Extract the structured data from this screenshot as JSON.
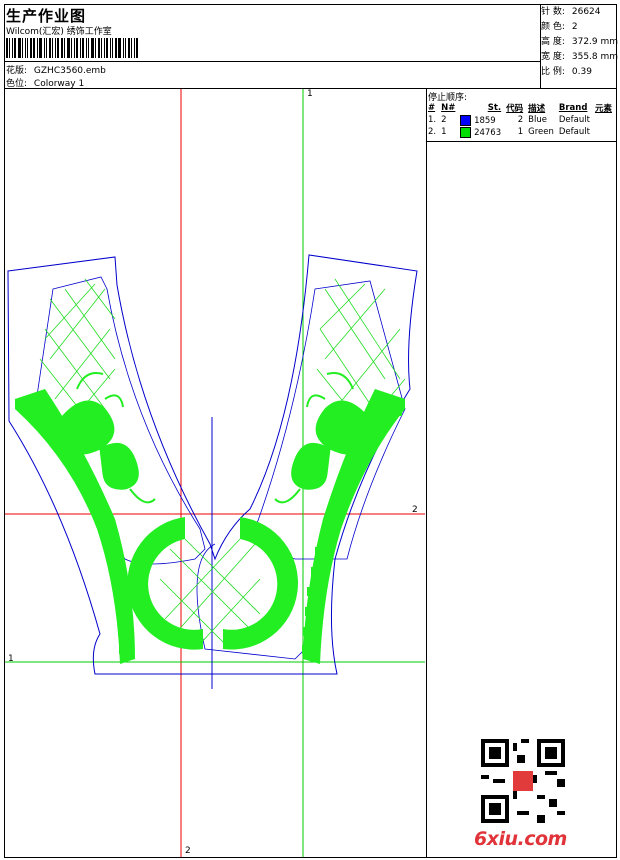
{
  "header": {
    "title": "生产作业图",
    "company": "Wilcom(汇宏) 绣饰工作室",
    "design_label": "花版:",
    "design_value": "GZHC3560.emb",
    "colorway_label": "色位:",
    "colorway_value": "Colorway 1"
  },
  "stats": [
    {
      "label": "针 数:",
      "value": "26624"
    },
    {
      "label": "颜 色:",
      "value": "2"
    },
    {
      "label": "高 度:",
      "value": "372.9 mm"
    },
    {
      "label": "宽 度:",
      "value": "355.8 mm"
    },
    {
      "label": "比 例:",
      "value": "0.39"
    }
  ],
  "sequence": {
    "title": "停止顺序:",
    "headers": [
      "#",
      "N#",
      "St.",
      "代码",
      "描述",
      "Brand",
      "元素"
    ],
    "rows": [
      {
        "num": "1.",
        "n": "2",
        "color": "#0000ff",
        "st": "1859",
        "code": "2",
        "desc": "Blue",
        "brand": "Default",
        "element": ""
      },
      {
        "num": "2.",
        "n": "1",
        "color": "#00dd00",
        "st": "24763",
        "code": "1",
        "desc": "Green",
        "brand": "Default",
        "element": ""
      }
    ]
  },
  "axis_labels": {
    "top": "1",
    "right": "2",
    "left": "1",
    "bottom": "2"
  },
  "colors": {
    "outline": "#0000cc",
    "fill": "#22ee22",
    "red_axis": "#ee0000",
    "green_axis": "#00cc00"
  },
  "watermark": {
    "brand": "6xiu.com",
    "qr_icon": "qr-code-icon"
  }
}
